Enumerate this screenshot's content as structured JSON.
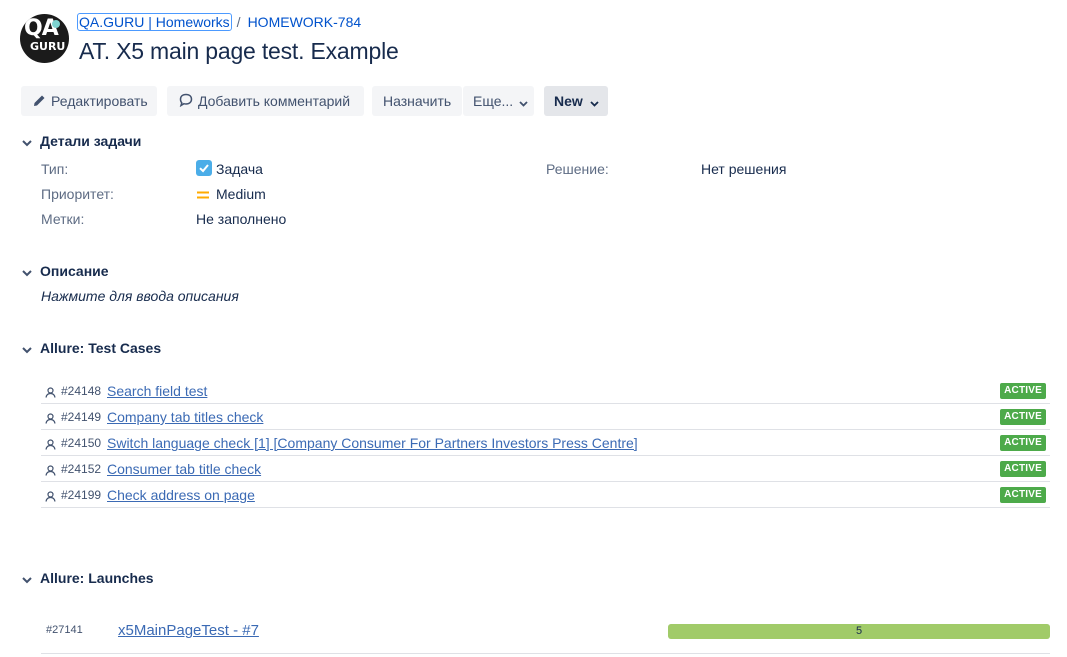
{
  "header": {
    "breadcrumbs": [
      "QA.GURU | Homeworks",
      "HOMEWORK-784"
    ],
    "separator": "/",
    "title": "AT. X5 main page test. Example",
    "logo_text": [
      "QA",
      "GURU"
    ]
  },
  "toolbar": {
    "edit_label": "Редактировать",
    "comment_label": "Добавить комментарий",
    "assign_label": "Назначить",
    "more_label": "Еще...",
    "status_label": "New"
  },
  "details": {
    "heading": "Детали задачи",
    "type_label": "Тип:",
    "type_value": "Задача",
    "priority_label": "Приоритет:",
    "priority_value": "Medium",
    "labels_label": "Метки:",
    "labels_value": "Не заполнено",
    "resolution_label": "Решение:",
    "resolution_value": "Нет решения"
  },
  "description": {
    "heading": "Описание",
    "placeholder": "Нажмите для ввода описания"
  },
  "test_cases": {
    "heading": "Allure: Test Cases",
    "items": [
      {
        "id": "#24148",
        "name": "Search field test",
        "status": "ACTIVE"
      },
      {
        "id": "#24149",
        "name": "Company tab titles check",
        "status": "ACTIVE"
      },
      {
        "id": "#24150",
        "name": "Switch language check [1] [Company Consumer For Partners Investors Press Centre]",
        "status": "ACTIVE"
      },
      {
        "id": "#24152",
        "name": "Consumer tab title check",
        "status": "ACTIVE"
      },
      {
        "id": "#24199",
        "name": "Check address on page",
        "status": "ACTIVE"
      }
    ]
  },
  "launches": {
    "heading": "Allure: Launches",
    "items": [
      {
        "id": "#27141",
        "name": "x5MainPageTest - #7",
        "passed": "5",
        "passed_fraction": 1.0
      }
    ]
  },
  "colors": {
    "link": "#0052cc",
    "active_badge": "#4daa4a",
    "progress_passed": "#a1cb69",
    "priority_medium": "#ffab00",
    "task_icon": "#4bade8"
  },
  "icons": {
    "edit": "pencil-icon",
    "comment": "speech-bubble-icon",
    "dropdown": "chevron-down-icon",
    "section_toggle": "chevron-down-icon",
    "task_type": "checkbox-task-icon",
    "priority": "priority-medium-icon",
    "test_case": "user-icon"
  }
}
